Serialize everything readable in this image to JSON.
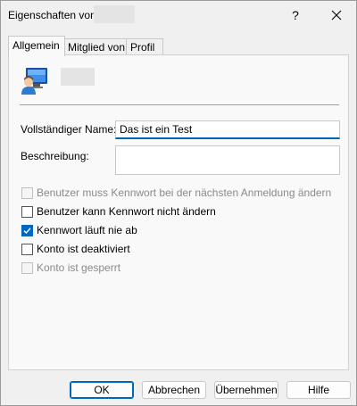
{
  "window": {
    "title": "Eigenschaften von",
    "help_glyph": "?",
    "close_icon": "close-icon"
  },
  "tabs": [
    {
      "label": "Allgemein",
      "active": true
    },
    {
      "label": "Mitglied von",
      "active": false
    },
    {
      "label": "Profil",
      "active": false
    }
  ],
  "general": {
    "user_icon": "user-monitor-icon",
    "full_name_label": "Vollständiger Name:",
    "full_name_value": "Das ist ein Test",
    "description_label": "Beschreibung:",
    "description_value": ""
  },
  "options": [
    {
      "label": "Benutzer muss Kennwort bei der nächsten Anmeldung ändern",
      "checked": false,
      "enabled": false
    },
    {
      "label": "Benutzer kann Kennwort nicht ändern",
      "checked": false,
      "enabled": true
    },
    {
      "label": "Kennwort läuft nie ab",
      "checked": true,
      "enabled": true
    },
    {
      "label": "Konto ist deaktiviert",
      "checked": false,
      "enabled": true
    },
    {
      "label": "Konto ist gesperrt",
      "checked": false,
      "enabled": false
    }
  ],
  "buttons": {
    "ok": "OK",
    "cancel": "Abbrechen",
    "apply": "Übernehmen",
    "help": "Hilfe"
  },
  "colors": {
    "accent": "#0067c0"
  }
}
